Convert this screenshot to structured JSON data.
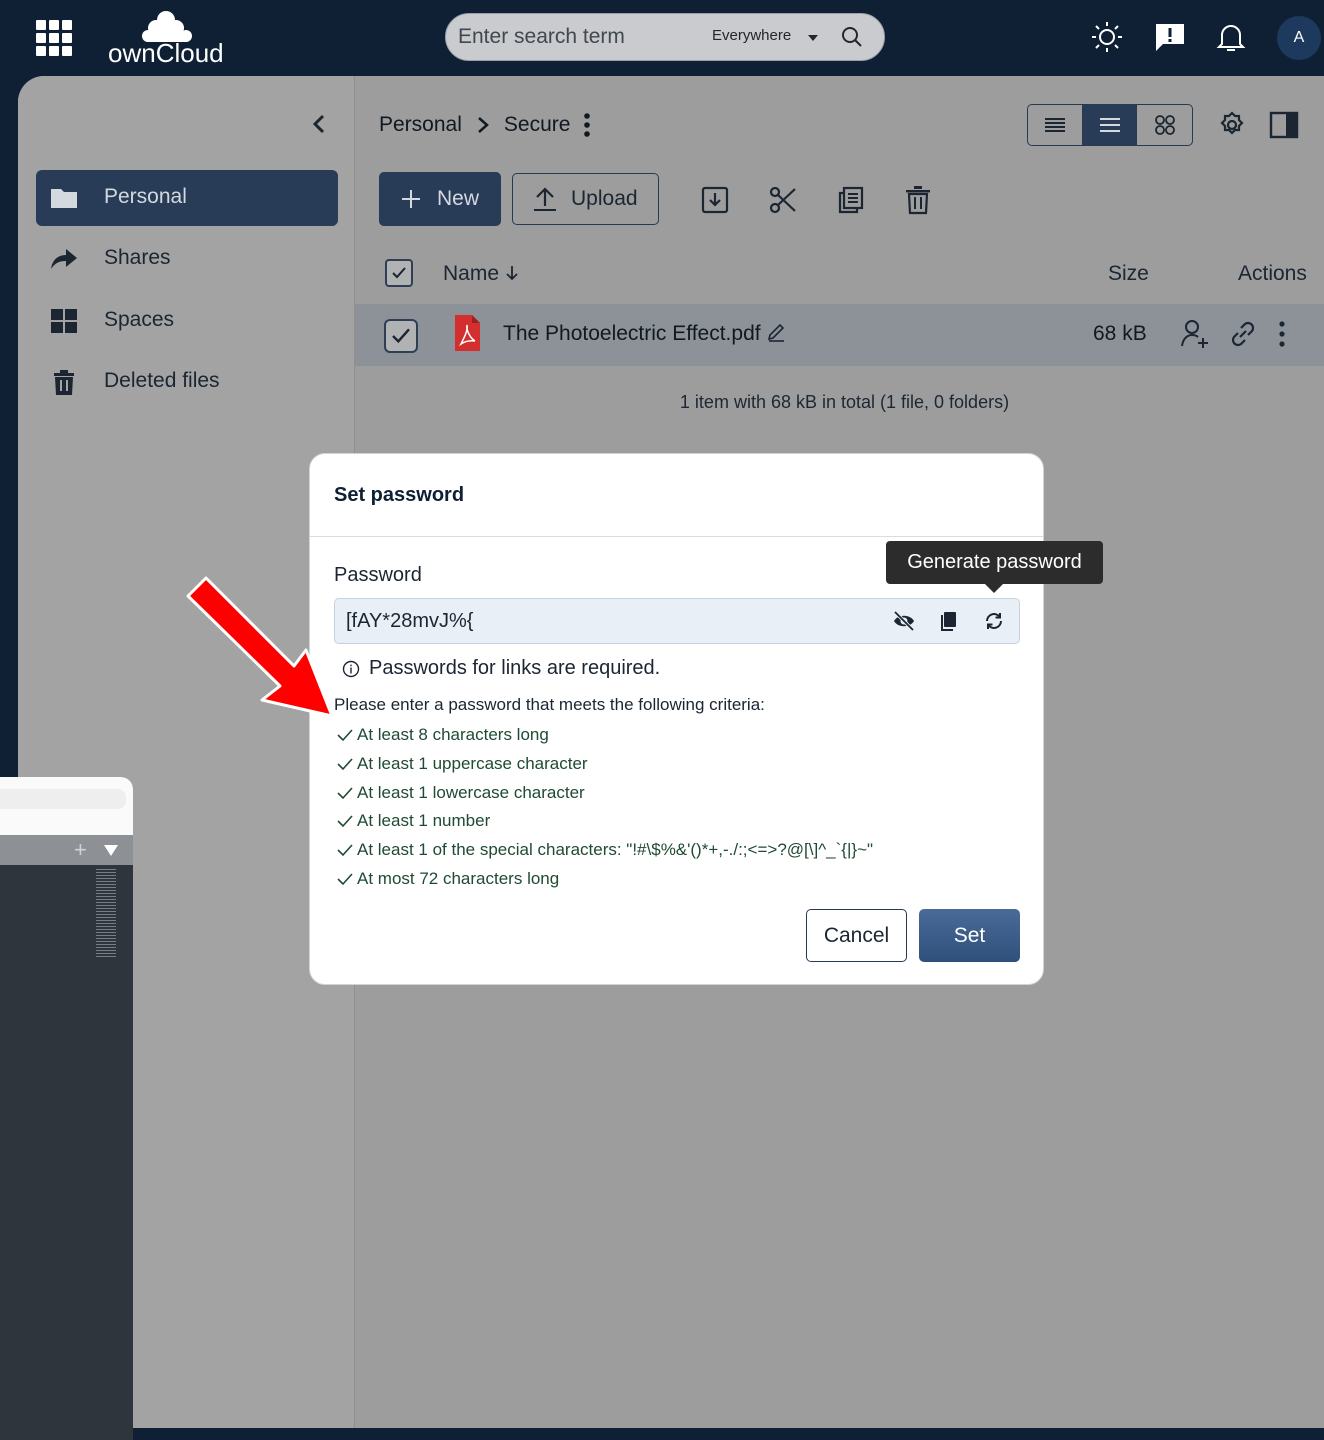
{
  "header": {
    "brand": "ownCloud",
    "search": {
      "placeholder": "Enter search term",
      "scope": "Everywhere"
    },
    "avatar_initial": "A",
    "icons": [
      "app-switcher-icon",
      "theme-toggle-icon",
      "feedback-icon",
      "notifications-icon",
      "search-icon"
    ]
  },
  "sidebar": {
    "items": [
      {
        "label": "Personal",
        "icon": "folder-icon",
        "active": true
      },
      {
        "label": "Shares",
        "icon": "share-icon",
        "active": false
      },
      {
        "label": "Spaces",
        "icon": "spaces-grid-icon",
        "active": false
      },
      {
        "label": "Deleted files",
        "icon": "trash-icon",
        "active": false
      }
    ]
  },
  "breadcrumb": {
    "items": [
      "Personal",
      "Secure"
    ]
  },
  "toolbar": {
    "new_label": "New",
    "upload_label": "Upload"
  },
  "table": {
    "headers": {
      "name": "Name",
      "size": "Size",
      "actions": "Actions"
    },
    "rows": [
      {
        "name": "The Photoelectric Effect.pdf",
        "size": "68 kB",
        "selected": true
      }
    ],
    "summary": "1 item with 68 kB in total (1 file, 0 folders)"
  },
  "modal": {
    "title": "Set password",
    "field_label": "Password",
    "password_value": "[fAY*28mvJ%{",
    "required_note": "Passwords for links are required.",
    "criteria_intro": "Please enter a password that meets the following criteria:",
    "criteria": [
      "At least 8 characters long",
      "At least 1 uppercase character",
      "At least 1 lowercase character",
      "At least 1 number",
      "At least 1 of the special characters: \"!#\\$%&'()*+,-./:;<=>?@[\\]^_`{|}~\"",
      "At most 72 characters long"
    ],
    "cancel_label": "Cancel",
    "set_label": "Set",
    "tooltip": "Generate password"
  },
  "colors": {
    "topbar": "#0f2035",
    "primary": "#283c58",
    "annotation_arrow": "#ff0000",
    "criteria_ok": "#1f4a33"
  }
}
